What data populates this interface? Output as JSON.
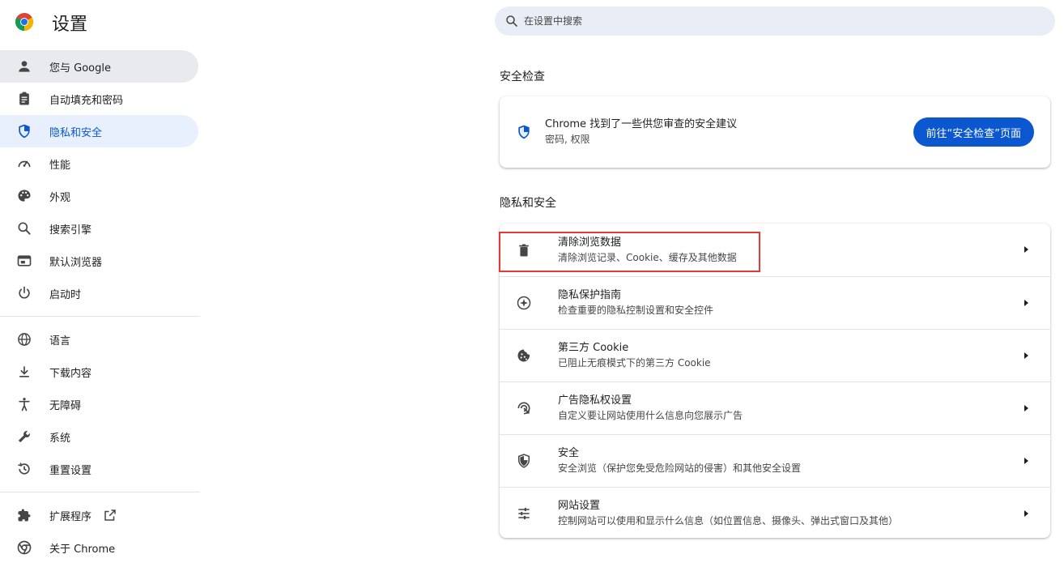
{
  "header": {
    "title": "设置",
    "search_placeholder": "在设置中搜索"
  },
  "sidebar": {
    "items": [
      {
        "label": "您与 Google",
        "icon": "person-icon",
        "state": "hover"
      },
      {
        "label": "自动填充和密码",
        "icon": "clipboard-icon"
      },
      {
        "label": "隐私和安全",
        "icon": "shield-icon",
        "state": "active"
      },
      {
        "label": "性能",
        "icon": "speedometer-icon"
      },
      {
        "label": "外观",
        "icon": "palette-icon"
      },
      {
        "label": "搜索引擎",
        "icon": "search-icon"
      },
      {
        "label": "默认浏览器",
        "icon": "browser-icon"
      },
      {
        "label": "启动时",
        "icon": "power-icon"
      },
      {
        "label": "语言",
        "icon": "globe-icon"
      },
      {
        "label": "下载内容",
        "icon": "download-icon"
      },
      {
        "label": "无障碍",
        "icon": "accessibility-icon"
      },
      {
        "label": "系统",
        "icon": "wrench-icon"
      },
      {
        "label": "重置设置",
        "icon": "history-icon"
      },
      {
        "label": "扩展程序",
        "icon": "puzzle-icon"
      },
      {
        "label": "关于 Chrome",
        "icon": "chrome-icon"
      }
    ]
  },
  "safety_check": {
    "section_title": "安全检查",
    "primary": "Chrome 找到了一些供您审查的安全建议",
    "secondary": "密码, 权限",
    "button_label": "前往“安全检查”页面"
  },
  "privacy": {
    "section_title": "隐私和安全",
    "rows": [
      {
        "title": "清除浏览数据",
        "subtitle": "清除浏览记录、Cookie、缓存及其他数据",
        "icon": "trash-icon"
      },
      {
        "title": "隐私保护指南",
        "subtitle": "检查重要的隐私控制设置和安全控件",
        "icon": "compass-icon"
      },
      {
        "title": "第三方 Cookie",
        "subtitle": "已阻止无痕模式下的第三方 Cookie",
        "icon": "cookie-icon"
      },
      {
        "title": "广告隐私权设置",
        "subtitle": "自定义要让网站使用什么信息向您展示广告",
        "icon": "ad-privacy-icon"
      },
      {
        "title": "安全",
        "subtitle": "安全浏览（保护您免受危险网站的侵害）和其他安全设置",
        "icon": "shield-outline-icon"
      },
      {
        "title": "网站设置",
        "subtitle": "控制网站可以使用和显示什么信息（如位置信息、摄像头、弹出式窗口及其他）",
        "icon": "tune-icon"
      }
    ]
  },
  "colors": {
    "accent": "#0b57d0",
    "active_bg": "#e8f0fe",
    "hover_bg": "#e8eaed",
    "highlight": "#e53935"
  }
}
